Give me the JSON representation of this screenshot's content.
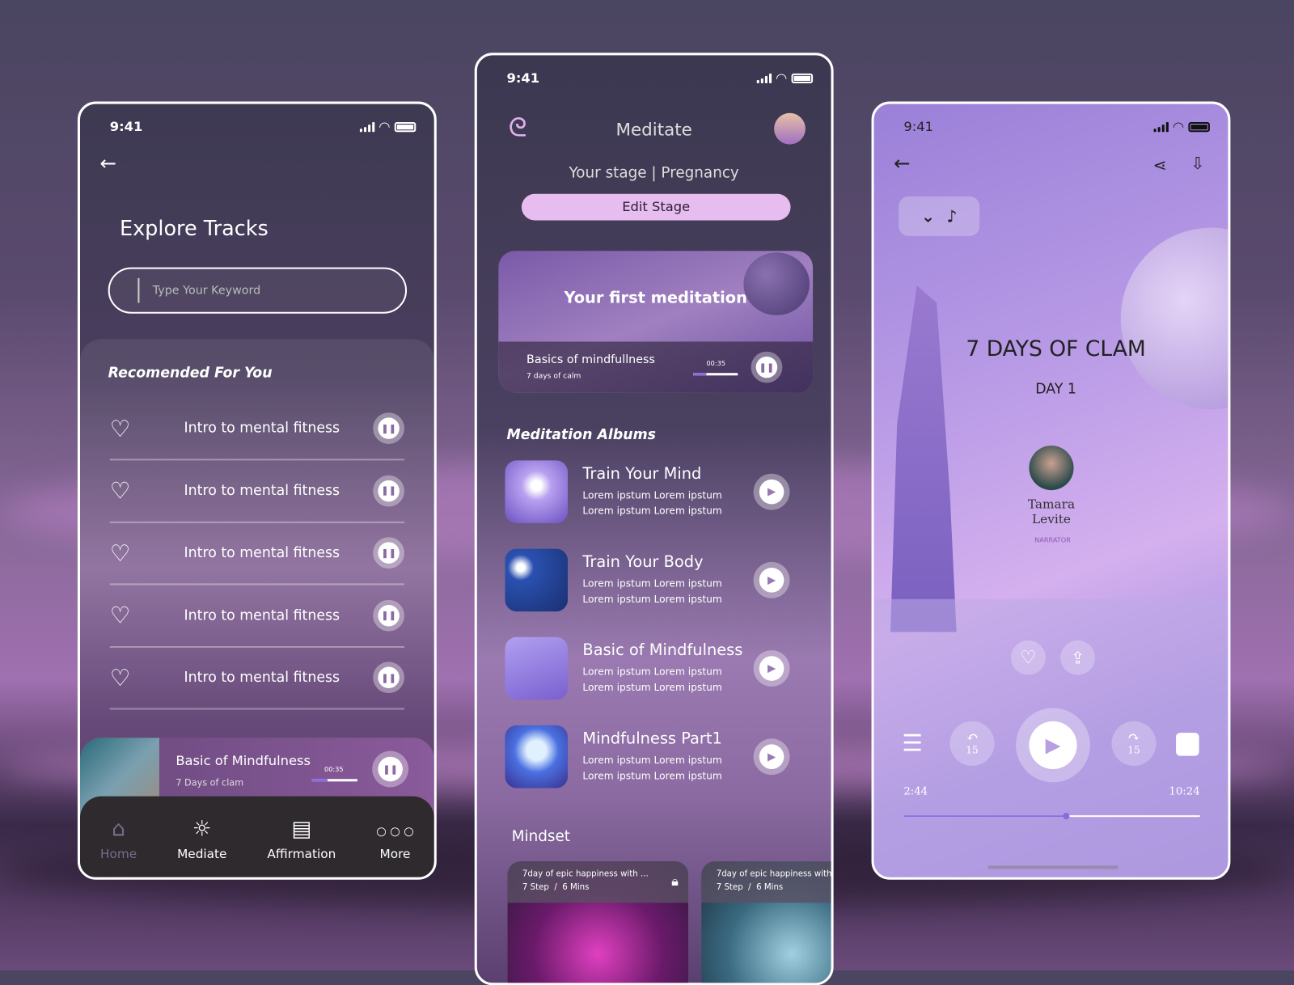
{
  "status_time": "9:41",
  "left": {
    "title": "Explore Tracks",
    "search_placeholder": "Type Your Keyword",
    "section": "Recomended For You",
    "tracks": [
      "Intro to mental fitness",
      "Intro to mental fitness",
      "Intro to mental fitness",
      "Intro to mental fitness",
      "Intro to mental fitness"
    ],
    "mini_player": {
      "title": "Basic of Mindfulness",
      "subtitle": "7 Days of clam",
      "time": "00:35",
      "progress": 0.35
    },
    "nav": [
      {
        "label": "Home",
        "icon": "home-icon"
      },
      {
        "label": "Mediate",
        "icon": "sun-icon"
      },
      {
        "label": "Affirmation",
        "icon": "book-icon"
      },
      {
        "label": "More",
        "icon": "more-icon"
      }
    ]
  },
  "middle": {
    "title": "Meditate",
    "stage_label": "Your stage",
    "stage_value": "Pregnancy",
    "edit_stage": "Edit Stage",
    "hero": {
      "title": "Your first meditation",
      "track": "Basics of mindfullness",
      "subtitle": "7 days of calm",
      "time": "00:35",
      "progress": 0.3
    },
    "albums_heading": "Meditation Albums",
    "albums": [
      {
        "title": "Train Your Mind",
        "line1": "Lorem ipstum Lorem ipstum",
        "line2": "Lorem ipstum Lorem ipstum"
      },
      {
        "title": "Train Your Body",
        "line1": "Lorem ipstum Lorem ipstum",
        "line2": "Lorem ipstum Lorem ipstum"
      },
      {
        "title": "Basic of Mindfulness",
        "line1": "Lorem ipstum Lorem ipstum",
        "line2": "Lorem ipstum Lorem ipstum"
      },
      {
        "title": "Mindfulness Part1",
        "line1": "Lorem ipstum Lorem ipstum",
        "line2": "Lorem ipstum Lorem ipstum"
      }
    ],
    "mindset_heading": "Mindset",
    "mindset": [
      {
        "title": "7day of epic happiness with ...",
        "meta": "7 Step  /  6 Mins"
      },
      {
        "title": "7day of epic happiness with",
        "meta": "7 Step  /  6 Mins"
      }
    ]
  },
  "right": {
    "title": "7 DAYS OF CLAM",
    "day": "DAY 1",
    "narrator_name": "Tamara Levite",
    "narrator_role": "NARRATOR",
    "skip_back": "15",
    "skip_forward": "15",
    "elapsed": "2:44",
    "duration": "10:24",
    "progress": 0.55
  },
  "colors": {
    "accent": "#e7bdf0",
    "progress": "#8a6ae0"
  }
}
